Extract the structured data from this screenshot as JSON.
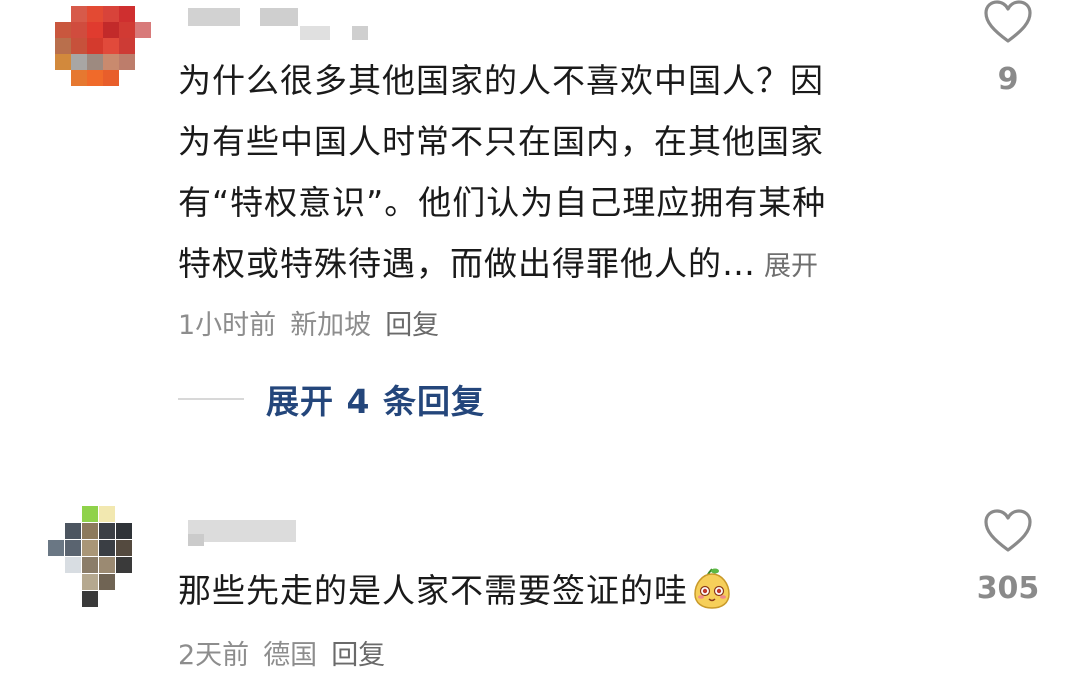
{
  "comments": [
    {
      "text": "为什么很多其他国家的人不喜欢中国人？因为有些中国人时常不只在国内，在其他国家有“特权意识”。他们认为自己理应拥有某种特权或特殊待遇，而做出得罪他人的…",
      "lines": [
        "为什么很多其他国家的人不喜欢中国人？因",
        "为有些中国人时常不只在国内，在其他国家",
        "有“特权意识”。他们认为自己理应拥有某种",
        "特权或特殊待遇，而做出得罪他人的…"
      ],
      "expand_label": "展开",
      "time": "1小时前",
      "location": "新加坡",
      "reply_label": "回复",
      "likes": "9",
      "replies_expand": "展开 4 条回复"
    },
    {
      "text": "那些先走的是人家不需要签证的哇",
      "time": "2天前",
      "location": "德国",
      "reply_label": "回复",
      "likes": "305",
      "emoji": "smiling-pear-emoji"
    }
  ],
  "colors": {
    "link": "#24467b",
    "meta": "#8d8d8d",
    "text": "#1a1a1a"
  }
}
